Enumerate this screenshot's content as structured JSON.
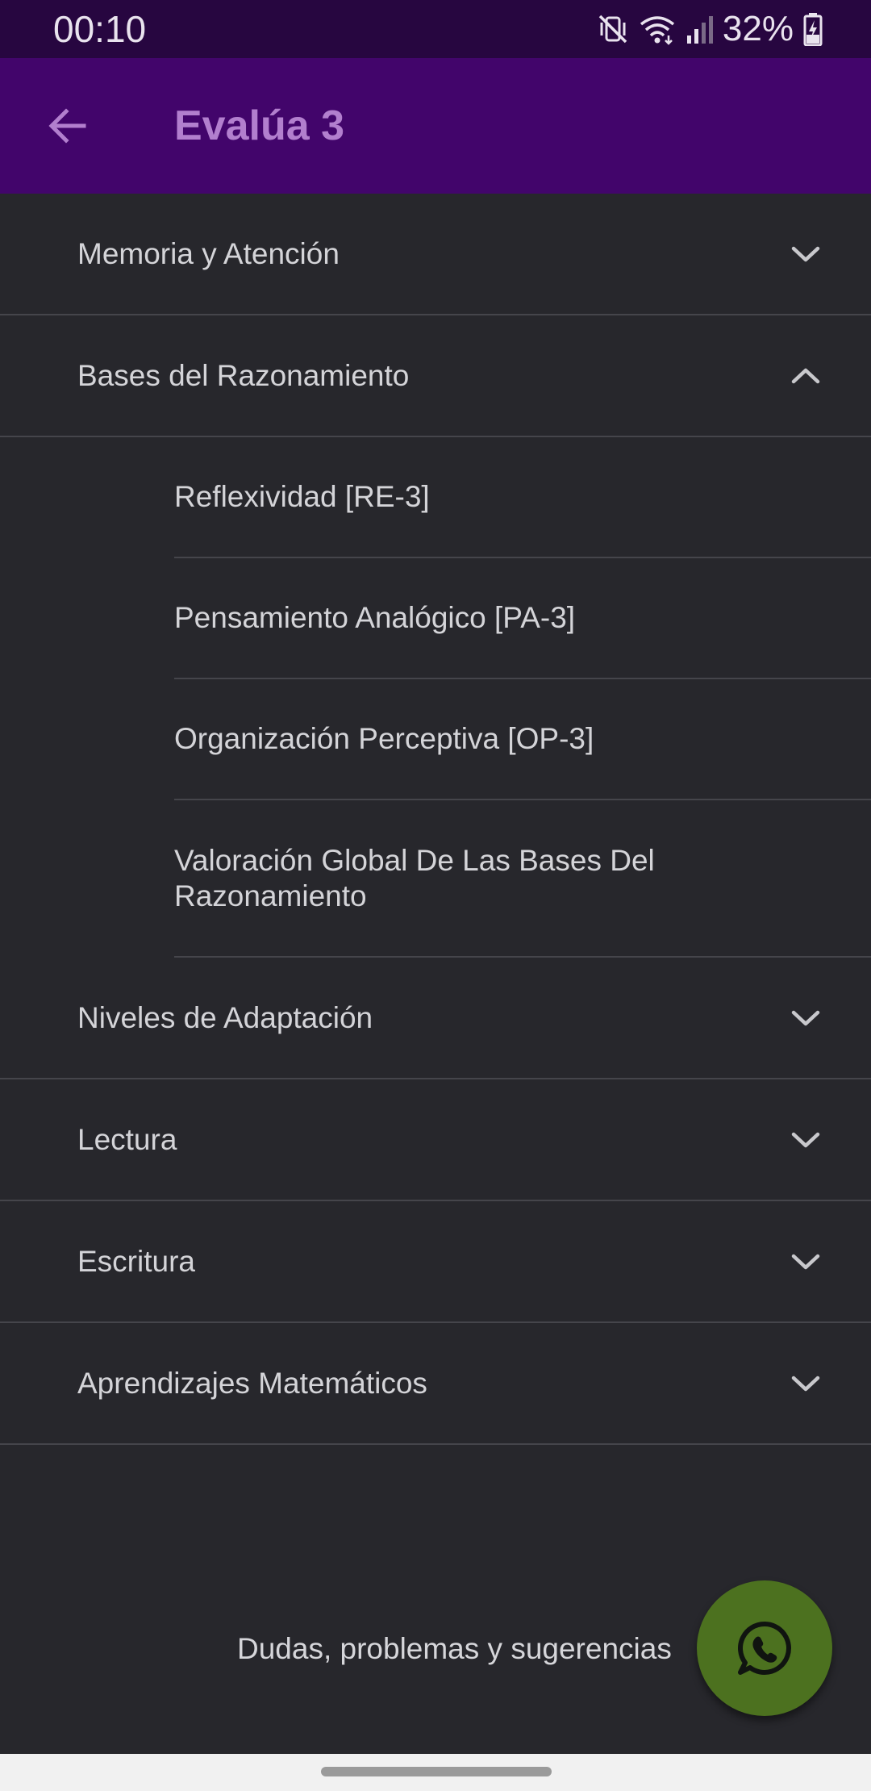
{
  "status_bar": {
    "time": "00:10",
    "battery_percent": "32%",
    "icons": [
      "mute-vibrate-icon",
      "wifi-icon",
      "signal-icon",
      "battery-charging-icon"
    ]
  },
  "app_bar": {
    "back_icon": "arrow-back-icon",
    "title": "Evalúa 3"
  },
  "colors": {
    "status_bar_bg": "#270640",
    "app_bar_bg": "#42056b",
    "title_color": "#b27fce",
    "background": "#27272c",
    "fab_bg": "#4c711f"
  },
  "sections": [
    {
      "label": "Memoria y Atención",
      "expanded": false
    },
    {
      "label": "Bases del Razonamiento",
      "expanded": true,
      "children": [
        "Reflexividad [RE-3]",
        "Pensamiento Analógico [PA-3]",
        "Organización Perceptiva [OP-3]",
        "Valoración Global De Las Bases Del Razonamiento"
      ]
    },
    {
      "label": "Niveles de Adaptación",
      "expanded": false
    },
    {
      "label": "Lectura",
      "expanded": false
    },
    {
      "label": "Escritura",
      "expanded": false
    },
    {
      "label": "Aprendizajes Matemáticos",
      "expanded": false
    }
  ],
  "footer": {
    "help_text": "Dudas, problemas y sugerencias",
    "fab_icon": "whatsapp-icon"
  }
}
